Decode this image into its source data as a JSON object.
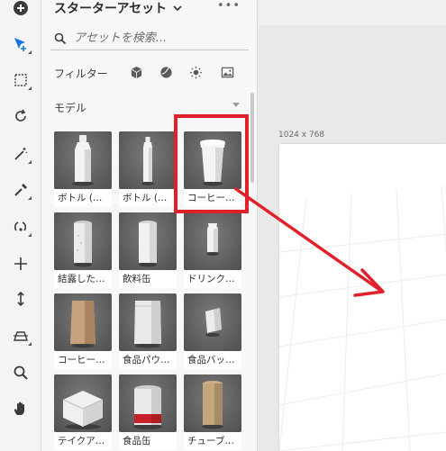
{
  "panel": {
    "title": "スターターアセット",
    "more_label": "•••",
    "search_placeholder": "アセットを検索...",
    "filter_label": "フィルター",
    "filter_icons": [
      "cube-icon",
      "material-sphere-icon",
      "light-icon",
      "image-icon"
    ],
    "section_label": "モデル",
    "assets": [
      {
        "label": "ボトル (…",
        "icon": "bottle-square-icon"
      },
      {
        "label": "ボトル (…",
        "icon": "bottle-slim-icon"
      },
      {
        "label": "コーヒー…",
        "icon": "coffee-cup-icon"
      },
      {
        "label": "結露した…",
        "icon": "condensation-can-icon"
      },
      {
        "label": "飲料缶",
        "icon": "beverage-can-icon"
      },
      {
        "label": "ドリンク…",
        "icon": "drink-carton-icon"
      },
      {
        "label": "コーヒー…",
        "icon": "coffee-bag-icon"
      },
      {
        "label": "食品パウ…",
        "icon": "food-pouch-icon"
      },
      {
        "label": "食品バッ…",
        "icon": "food-bag-icon"
      },
      {
        "label": "テイクア…",
        "icon": "takeout-box-icon"
      },
      {
        "label": "食品缶",
        "icon": "food-can-icon"
      },
      {
        "label": "チューブ…",
        "icon": "tube-icon"
      }
    ]
  },
  "tools": [
    "select-tool-icon",
    "frame-tool-icon",
    "rotate-tool-icon",
    "magic-wand-icon",
    "eyedropper-icon",
    "orbit-icon",
    "move-icon",
    "dolly-icon",
    "perspective-icon",
    "zoom-icon",
    "hand-icon"
  ],
  "canvas": {
    "size_label": "1024 x 768"
  },
  "annotation": {
    "color": "#e0212a"
  }
}
